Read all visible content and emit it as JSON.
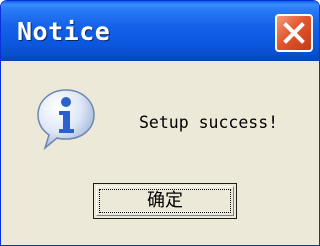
{
  "dialog": {
    "title": "Notice",
    "message": "Setup success!",
    "ok_label": "确定",
    "icon": "information-icon",
    "close_icon": "close-icon"
  },
  "colors": {
    "titlebar": "#1663e9",
    "close_button": "#e2572f",
    "client_background": "#ece9d8",
    "info_icon": "#2d5fd1"
  }
}
